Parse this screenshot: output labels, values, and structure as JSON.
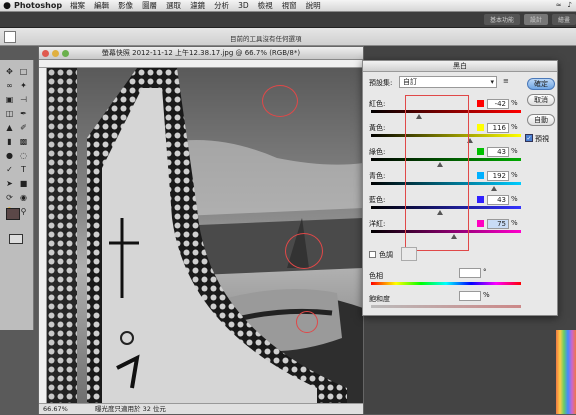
{
  "menubar": {
    "apple": "",
    "app": "Photoshop",
    "items": [
      "檔案",
      "編輯",
      "影像",
      "圖層",
      "選取",
      "濾鏡",
      "分析",
      "3D",
      "檢視",
      "視窗",
      "說明"
    ]
  },
  "appbar": {
    "workspaces": [
      "基本功能",
      "設計",
      "繪畫"
    ]
  },
  "optbar": {
    "hint": "目前的工具沒有任何選項"
  },
  "doc": {
    "title": "螢幕快照 2012-11-12 上午12.38.17.jpg @ 66.7% (RGB/8*)",
    "zoom": "66.67%",
    "status": "曝光度只適用於 32 位元"
  },
  "dialog": {
    "title": "黑白",
    "preset_label": "預設集:",
    "preset_value": "自訂",
    "buttons": {
      "ok": "確定",
      "cancel": "取消",
      "auto": "自動"
    },
    "preview_label": "預視",
    "sliders": [
      {
        "label": "紅色:",
        "value": "-42",
        "pct": "%",
        "color": "#ff0000",
        "pos": 0.32
      },
      {
        "label": "黃色:",
        "value": "116",
        "pct": "%",
        "color": "#ffff00",
        "pos": 0.66
      },
      {
        "label": "綠色:",
        "value": "43",
        "pct": "%",
        "color": "#00c000",
        "pos": 0.46
      },
      {
        "label": "青色:",
        "value": "192",
        "pct": "%",
        "color": "#00b0ff",
        "pos": 0.82
      },
      {
        "label": "藍色:",
        "value": "43",
        "pct": "%",
        "color": "#3020ff",
        "pos": 0.46
      },
      {
        "label": "洋紅:",
        "value": "75",
        "pct": "%",
        "color": "#ff00c0",
        "pos": 0.55
      }
    ],
    "tint_label": "色調",
    "hue_label": "色相",
    "hue_unit": "°",
    "sat_label": "飽和度",
    "sat_unit": "%"
  }
}
